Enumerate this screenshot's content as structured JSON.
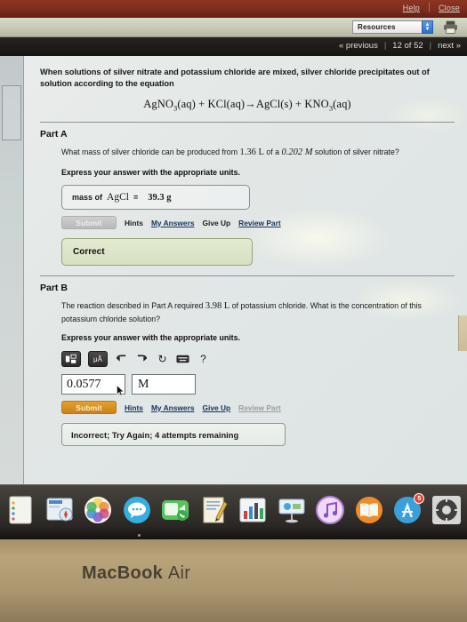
{
  "chrome": {
    "help_label": "Help",
    "close_label": "Close",
    "resources_label": "Resources",
    "printer_icon": "printer-icon",
    "prev_label": "« previous",
    "counter_label": "12 of 52",
    "next_label": "next »"
  },
  "problem": {
    "intro": "When solutions of silver nitrate and potassium chloride are mixed, silver chloride precipitates out of solution according to the equation",
    "equation_plain": "AgNO3(aq) + KCl(aq)→AgCl(s) + KNO3(aq)",
    "equation_parts": {
      "r1": "AgNO",
      "r1sub": "3",
      "r1aq": "(aq)",
      "plus1": "+",
      "r2": "KCl(aq)",
      "arrow": "→",
      "p1": "AgCl(s)",
      "plus2": "+",
      "p2": "KNO",
      "p2sub": "3",
      "p2aq": "(aq)"
    }
  },
  "partA": {
    "title": "Part A",
    "question_pre": "What mass of silver chloride can be produced from ",
    "question_vol": "1.36 L",
    "question_mid": " of a ",
    "question_conc": "0.202 M",
    "question_post": " solution of silver nitrate?",
    "express": "Express your answer with the appropriate units.",
    "answer_label": "mass of ",
    "answer_species": "AgCl",
    "answer_eq": "=",
    "answer_value": "39.3 g",
    "submit_label": "Submit",
    "submit_state": "disabled",
    "links": [
      "Hints",
      "My Answers",
      "Give Up",
      "Review Part"
    ],
    "feedback": "Correct"
  },
  "partB": {
    "title": "Part B",
    "question_pre": "The reaction described in Part A required ",
    "question_vol": "3.98 L",
    "question_post": " of potassium chloride. What is the concentration of this potassium chloride solution?",
    "express": "Express your answer with the appropriate units.",
    "toolbar": [
      {
        "name": "template-icon",
        "glyph": "▣"
      },
      {
        "name": "units-icon",
        "glyph": "μÅ"
      },
      {
        "name": "undo-icon",
        "glyph": "↰"
      },
      {
        "name": "redo-icon",
        "glyph": "↱"
      },
      {
        "name": "reset-icon",
        "glyph": "↻"
      },
      {
        "name": "keyboard-icon",
        "glyph": "▭"
      },
      {
        "name": "help-icon",
        "glyph": "?"
      }
    ],
    "value_input": "0.0577",
    "unit_input": "M",
    "submit_label": "Submit",
    "submit_state": "active",
    "links": [
      "Hints",
      "My Answers",
      "Give Up",
      "Review Part"
    ],
    "feedback": "Incorrect; Try Again; 4 attempts remaining"
  },
  "dock": {
    "items": [
      {
        "name": "dock-contacts-icon",
        "color1": "#f2f2ee",
        "color2": "#d8d8d0"
      },
      {
        "name": "dock-safari-icon",
        "color1": "#dfe8ef",
        "color2": "#9fb8cd"
      },
      {
        "name": "dock-photos-icon",
        "color1": "#f8f2ea",
        "color2": "#e7d7c2"
      },
      {
        "name": "dock-messages-icon",
        "color1": "#4ec0e8",
        "color2": "#1f86c4"
      },
      {
        "name": "dock-facetime-icon",
        "color1": "#7ed67a",
        "color2": "#2ea84a"
      },
      {
        "name": "dock-pages-icon",
        "color1": "#f5d88a",
        "color2": "#d9a23f"
      },
      {
        "name": "dock-numbers-icon",
        "color1": "#e6eaf0",
        "color2": "#c4cbd6"
      },
      {
        "name": "dock-keynote-icon",
        "color1": "#dfe9f2",
        "color2": "#a6c0d6"
      },
      {
        "name": "dock-itunes-icon",
        "color1": "#e9c6ec",
        "color2": "#b07ed8"
      },
      {
        "name": "dock-ibooks-icon",
        "color1": "#f7b43f",
        "color2": "#e2671f"
      },
      {
        "name": "dock-appstore-icon",
        "color1": "#57b7e8",
        "color2": "#1f6fc0",
        "badge": "5"
      },
      {
        "name": "dock-system-preferences-icon",
        "color1": "#cfcfcf",
        "color2": "#8a8a8a"
      }
    ]
  },
  "laptop": {
    "brand": "MacBook",
    "model": "Air"
  }
}
